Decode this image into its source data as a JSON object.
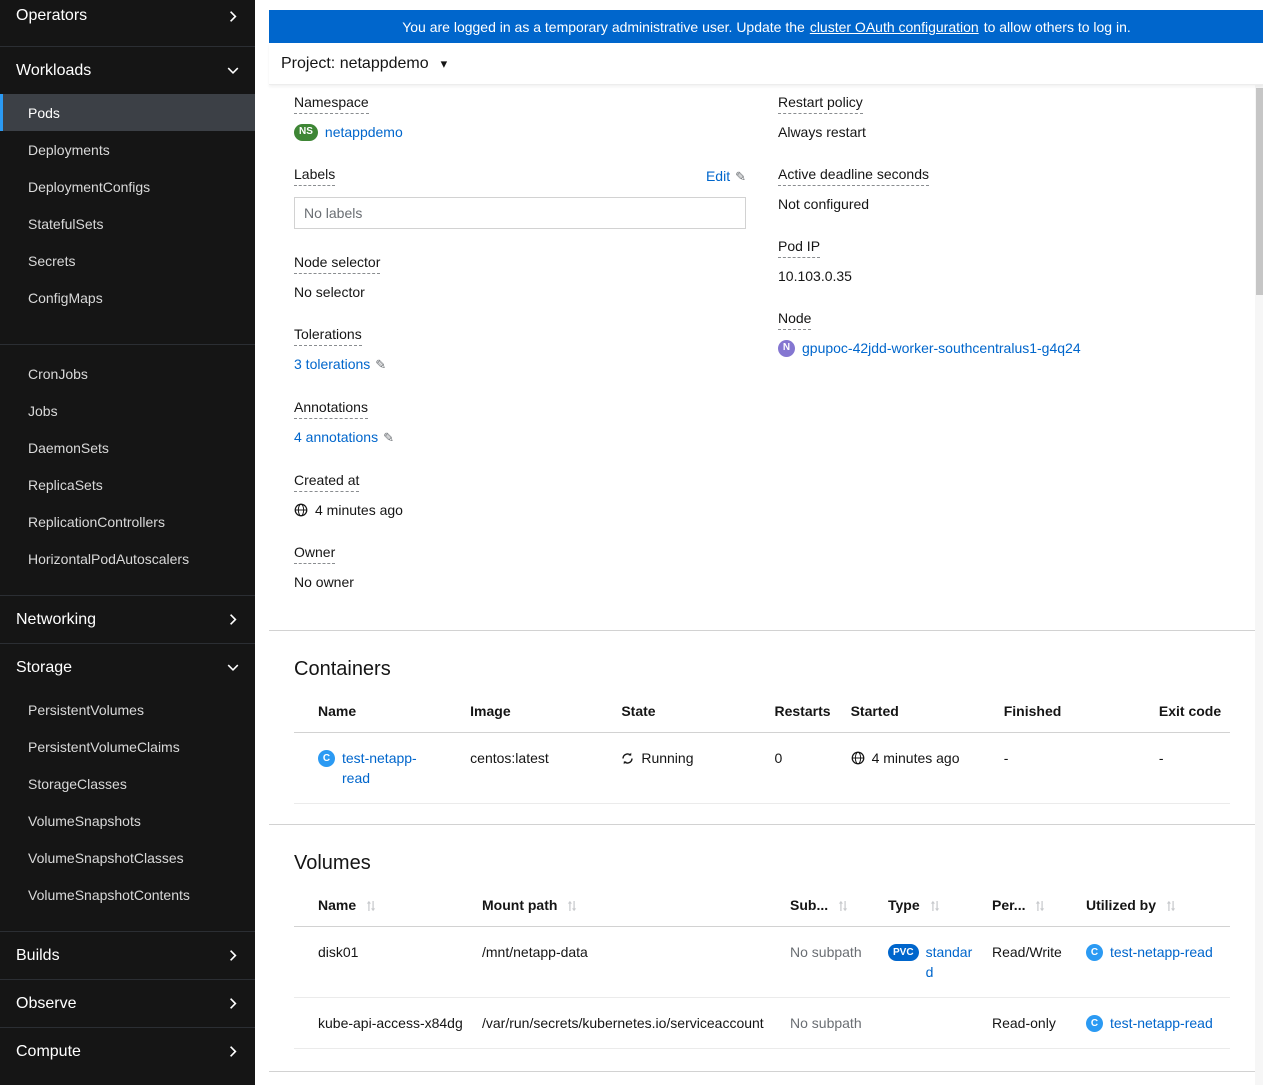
{
  "colors": {
    "banner_blue": "#0066cc",
    "link_blue": "#0066cc",
    "sidebar_bg": "#151515",
    "sidebar_selected_bg": "#3c4046",
    "sidebar_selected_border": "#2b9af3",
    "badge_namespace_green": "#3e8635",
    "badge_node_purple": "#8476d1",
    "badge_container_blue": "#2b9af3",
    "badge_pvc_blue": "#0066cc"
  },
  "icons": {
    "caret_down": "▾",
    "pencil": "✎"
  },
  "banner": {
    "text_before": "You are logged in as a temporary administrative user. Update the",
    "link_text": "cluster OAuth configuration",
    "text_after": "to allow others to log in."
  },
  "project_bar": {
    "label": "Project: netappdemo"
  },
  "sidebar": {
    "operators": "Operators",
    "workloads": {
      "label": "Workloads",
      "group1": [
        "Pods",
        "Deployments",
        "DeploymentConfigs",
        "StatefulSets",
        "Secrets",
        "ConfigMaps"
      ],
      "group2": [
        "CronJobs",
        "Jobs",
        "DaemonSets",
        "ReplicaSets",
        "ReplicationControllers",
        "HorizontalPodAutoscalers"
      ]
    },
    "networking": "Networking",
    "storage": {
      "label": "Storage",
      "items": [
        "PersistentVolumes",
        "PersistentVolumeClaims",
        "StorageClasses",
        "VolumeSnapshots",
        "VolumeSnapshotClasses",
        "VolumeSnapshotContents"
      ]
    },
    "builds": "Builds",
    "observe": "Observe",
    "compute": "Compute"
  },
  "details": {
    "namespace": {
      "label": "Namespace",
      "badge": "NS",
      "value": "netappdemo"
    },
    "labels": {
      "label": "Labels",
      "edit": "Edit",
      "empty": "No labels"
    },
    "node_selector": {
      "label": "Node selector",
      "value": "No selector"
    },
    "tolerations": {
      "label": "Tolerations",
      "link": "3 tolerations"
    },
    "annotations": {
      "label": "Annotations",
      "link": "4 annotations"
    },
    "created_at": {
      "label": "Created at",
      "value": "4 minutes ago"
    },
    "owner": {
      "label": "Owner",
      "value": "No owner"
    },
    "restart_policy": {
      "label": "Restart policy",
      "value": "Always restart"
    },
    "active_deadline": {
      "label": "Active deadline seconds",
      "value": "Not configured"
    },
    "pod_ip": {
      "label": "Pod IP",
      "value": "10.103.0.35"
    },
    "node": {
      "label": "Node",
      "badge": "N",
      "value": "gpupoc-42jdd-worker-southcentralus1-g4q24"
    }
  },
  "containers": {
    "title": "Containers",
    "headers": [
      "Name",
      "Image",
      "State",
      "Restarts",
      "Started",
      "Finished",
      "Exit code"
    ],
    "row": {
      "badge": "C",
      "name": "test-netapp-read",
      "image": "centos:latest",
      "state": "Running",
      "restarts": "0",
      "started": "4 minutes ago",
      "finished": "-",
      "exit_code": "-"
    }
  },
  "volumes": {
    "title": "Volumes",
    "headers": [
      "Name",
      "Mount path",
      "Sub...",
      "Type",
      "Per...",
      "Utilized by"
    ],
    "rows": [
      {
        "name": "disk01",
        "mount_path": "/mnt/netapp-data",
        "subpath": "No subpath",
        "type_badge": "PVC",
        "type": "standard",
        "permissions": "Read/Write",
        "utilized_badge": "C",
        "utilized_by": "test-netapp-read"
      },
      {
        "name": "kube-api-access-x84dg",
        "mount_path": "/var/run/secrets/kubernetes.io/serviceaccount",
        "subpath": "No subpath",
        "type_badge": "",
        "type": "",
        "permissions": "Read-only",
        "utilized_badge": "C",
        "utilized_by": "test-netapp-read"
      }
    ]
  }
}
